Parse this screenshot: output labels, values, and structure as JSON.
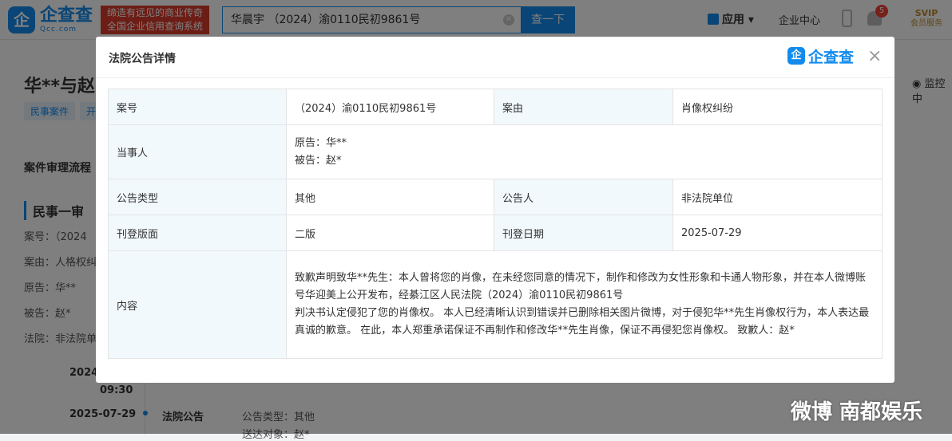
{
  "topbar": {
    "logo_mark": "企",
    "logo_name": "企查查",
    "logo_sub": "Qcc.com",
    "slogan_line1": "缔造有远见的商业传奇",
    "slogan_line2": "全国企业信用查询系统",
    "search_value": "华晨宇 （2024）渝0110民初9861号",
    "search_button": "查一下",
    "apps_label": "应用",
    "enterprise_center": "企业中心",
    "notification_count": "5",
    "svip_label": "SVIP",
    "svip_sub": "会员服务"
  },
  "background": {
    "title": "华**与赵",
    "tags": [
      "民事案件",
      "开"
    ],
    "monitor": "监控中",
    "section_title": "案件审理流程",
    "sub_title": "民事一审",
    "lines": [
      "案号：（2024",
      "案由：人格权纠",
      "原告：华**",
      "被告：赵*",
      "法院：非法院单"
    ],
    "time_year": "2024",
    "time_clock": "09:30",
    "event_date": "2025-07-29",
    "event_name": "法院公告",
    "event_type": "公告类型：其他",
    "event_party": "送达对象：赵*"
  },
  "modal": {
    "title": "法院公告详情",
    "logo_mark": "企",
    "logo_name": "企查查",
    "close": "×",
    "rows": {
      "case_no_label": "案号",
      "case_no_value": "（2024）渝0110民初9861号",
      "cause_label": "案由",
      "cause_value": "肖像权纠纷",
      "party_label": "当事人",
      "plaintiff": "原告：华**",
      "defendant": "被告：赵*",
      "type_label": "公告类型",
      "type_value": "其他",
      "announcer_label": "公告人",
      "announcer_value": "非法院单位",
      "layout_label": "刊登版面",
      "layout_value": "二版",
      "date_label": "刊登日期",
      "date_value": "2025-07-29",
      "content_label": "内容",
      "content_p1": "致歉声明致华**先生：本人曾将您的肖像，在未经您同意的情况下，制作和修改为女性形象和卡通人物形象，并在本人微博账号华迎美上公开发布，经綦江区人民法院（2024）渝0110民初9861号",
      "content_p2": "判决书认定侵犯了您的肖像权。 本人已经清晰认识到错误并已删除相关图片微博，对于侵犯华**先生肖像权行为，本人表达最真诚的歉意。 在此，本人郑重承诺保证不再制作和修改华**先生肖像，保证不再侵犯您肖像权。 致歉人：赵*"
    }
  },
  "watermark": "微博 南都娱乐",
  "colors": {
    "accent": "#128bed",
    "slogan_bg": "#d93a2b",
    "label_bg": "#f2f9fc"
  }
}
